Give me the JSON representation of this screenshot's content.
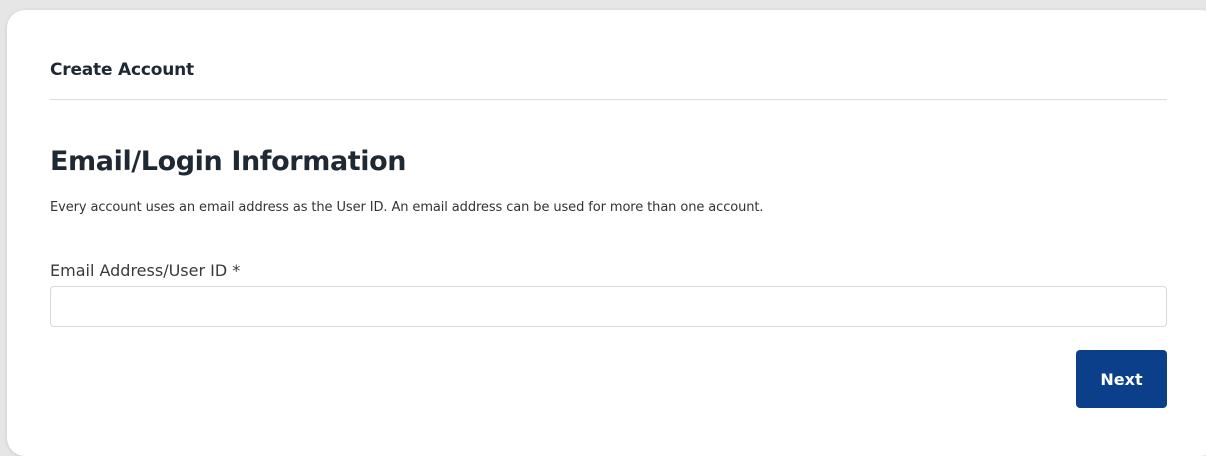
{
  "header": {
    "title": "Create Account"
  },
  "section": {
    "title": "Email/Login Information",
    "description": "Every account uses an email address as the User ID. An email address can be used for more than one account."
  },
  "email_field": {
    "label": "Email Address/User ID *",
    "value": "",
    "placeholder": ""
  },
  "actions": {
    "next_label": "Next"
  },
  "colors": {
    "primary_button": "#0b3f8a",
    "heading_text": "#1f2933",
    "divider": "#dcdcdc"
  }
}
